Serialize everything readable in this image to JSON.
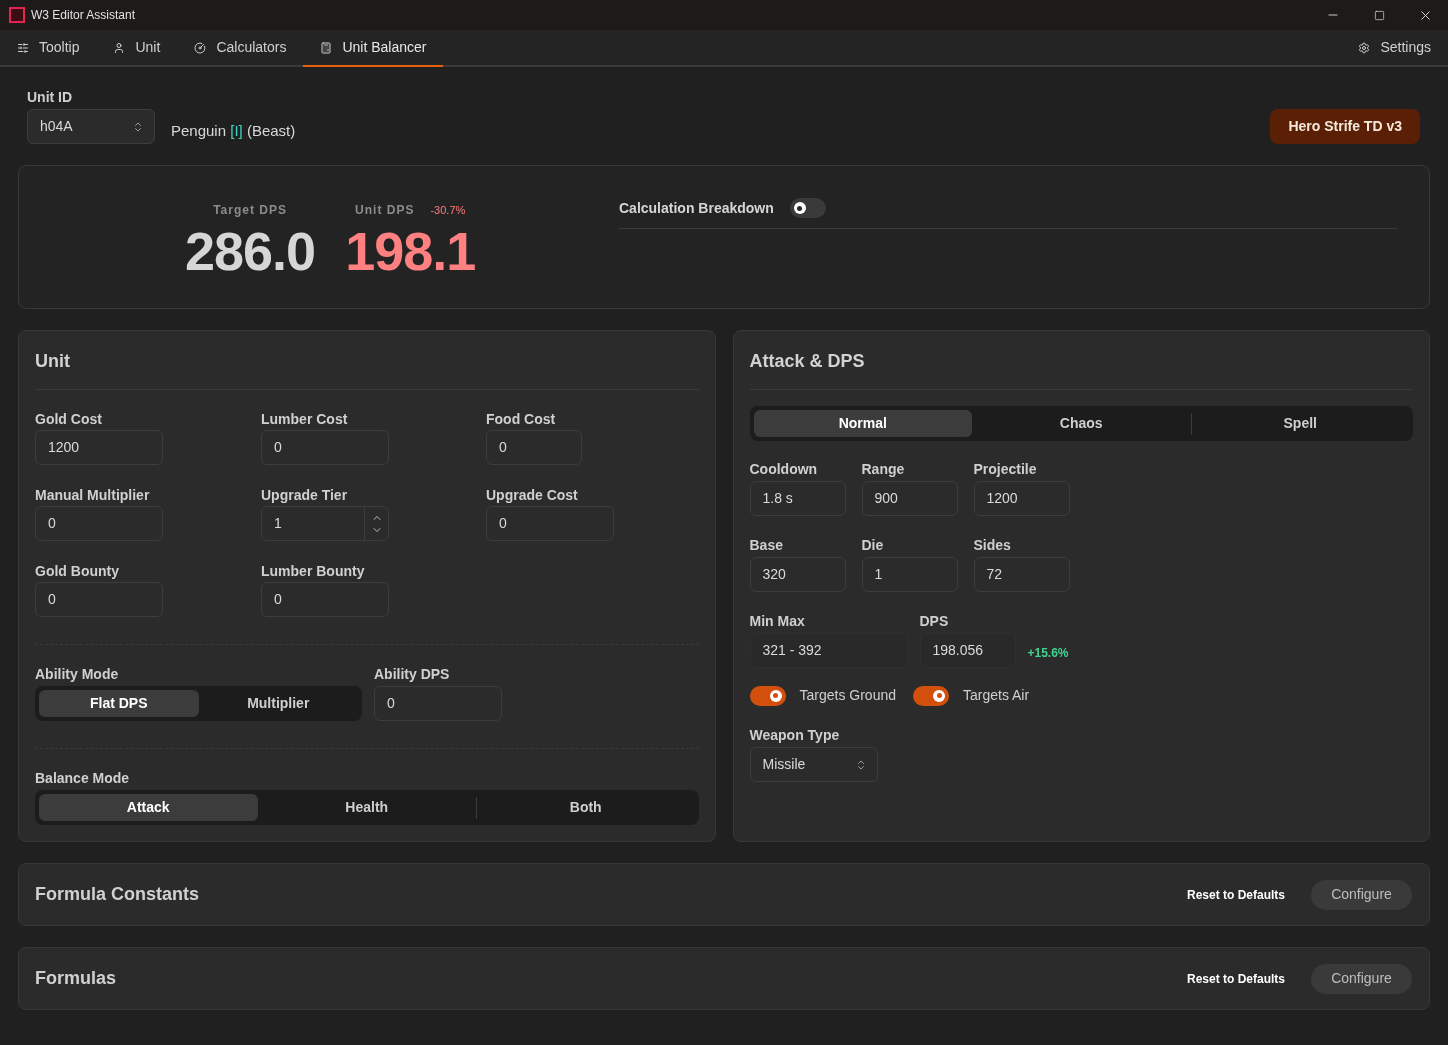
{
  "window": {
    "title": "W3 Editor Assistant"
  },
  "nav": {
    "tabs": [
      {
        "label": "Tooltip",
        "selected": false
      },
      {
        "label": "Unit",
        "selected": false
      },
      {
        "label": "Calculators",
        "selected": false
      },
      {
        "label": "Unit Balancer",
        "selected": true
      }
    ],
    "settings": "Settings"
  },
  "unit_id": {
    "label": "Unit ID",
    "value": "h04A"
  },
  "unit_name": {
    "name": "Penguin",
    "tag": "[I]",
    "type": "(Beast)"
  },
  "map_button": "Hero Strife TD v3",
  "summary": {
    "target": {
      "label": "Target DPS",
      "value": "286.0"
    },
    "unit": {
      "label": "Unit DPS",
      "change": "-30.7%",
      "positive": false,
      "value": "198.1"
    },
    "breakdown": {
      "label": "Calculation Breakdown",
      "on": false
    }
  },
  "unit_panel": {
    "title": "Unit",
    "fields": [
      {
        "label": "Gold Cost",
        "value": "1200",
        "kind": "input"
      },
      {
        "label": "Lumber Cost",
        "value": "0",
        "kind": "input"
      },
      {
        "label": "Food Cost",
        "value": "0",
        "kind": "input"
      },
      {
        "label": "Manual Multiplier",
        "value": "0",
        "kind": "input"
      },
      {
        "label": "Upgrade Tier",
        "value": "1",
        "kind": "spinner"
      },
      {
        "label": "Upgrade Cost",
        "value": "0",
        "kind": "input"
      },
      {
        "label": "Gold Bounty",
        "value": "0",
        "kind": "input"
      },
      {
        "label": "Lumber Bounty",
        "value": "0",
        "kind": "input"
      }
    ],
    "ability_mode": {
      "label": "Ability Mode",
      "options": [
        {
          "label": "Flat DPS",
          "selected": true
        },
        {
          "label": "Multiplier",
          "selected": false
        }
      ]
    },
    "ability_dps": {
      "label": "Ability DPS",
      "value": "0"
    },
    "balance_mode": {
      "label": "Balance Mode",
      "options": [
        {
          "label": "Attack",
          "selected": true
        },
        {
          "label": "Health",
          "selected": false
        },
        {
          "label": "Both",
          "selected": false
        }
      ]
    }
  },
  "attack_panel": {
    "title": "Attack & DPS",
    "damage_types": [
      {
        "label": "Normal",
        "selected": true
      },
      {
        "label": "Chaos",
        "selected": false
      },
      {
        "label": "Spell",
        "selected": false
      }
    ],
    "fields": [
      {
        "label": "Cooldown",
        "value": "1.8 s"
      },
      {
        "label": "Range",
        "value": "900"
      },
      {
        "label": "Projectile",
        "value": "1200"
      },
      {
        "label": "Base",
        "value": "320"
      },
      {
        "label": "Die",
        "value": "1"
      },
      {
        "label": "Sides",
        "value": "72"
      }
    ],
    "min_max": {
      "label": "Min Max",
      "value": "321 - 392"
    },
    "dps": {
      "label": "DPS",
      "value": "198.056",
      "change": "+15.6%",
      "positive": true
    },
    "targets": [
      {
        "label": "Targets Ground",
        "on": true
      },
      {
        "label": "Targets Air",
        "on": true
      }
    ],
    "weapon_type": {
      "label": "Weapon Type",
      "value": "Missile"
    }
  },
  "sections": [
    {
      "title": "Formula Constants",
      "reset": "Reset to Defaults",
      "configure": "Configure"
    },
    {
      "title": "Formulas",
      "reset": "Reset to Defaults",
      "configure": "Configure"
    }
  ]
}
